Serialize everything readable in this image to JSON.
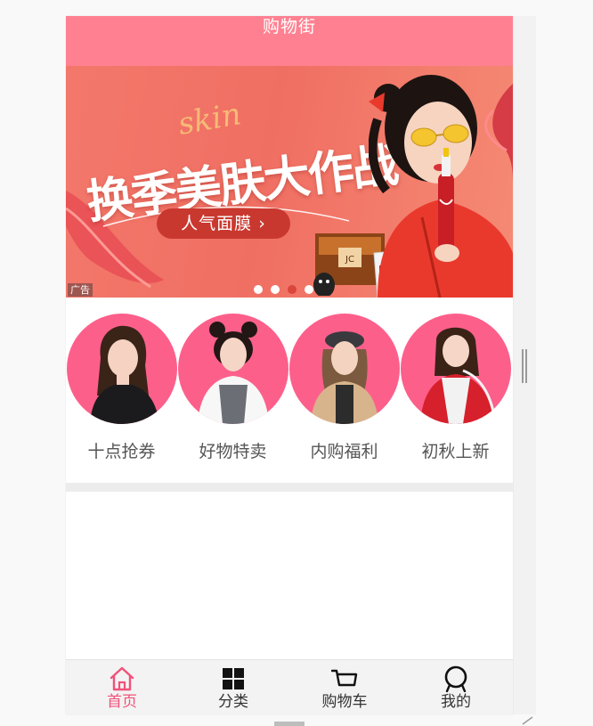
{
  "header": {
    "title": "购物街"
  },
  "banner": {
    "script_text": "skin",
    "headline": "换季美肤大作战",
    "cta_label": "人气面膜 ›",
    "ad_tag": "广告",
    "dots_total": 4,
    "active_dot": 3,
    "colors": {
      "background": "#f3786b",
      "cta": "#c9382f",
      "active_dot": "#d9463b"
    }
  },
  "categories": [
    {
      "label": "十点抢券",
      "icon": "model-black-sweater"
    },
    {
      "label": "好物特卖",
      "icon": "model-buns-white-shirt"
    },
    {
      "label": "内购福利",
      "icon": "model-beret-coat"
    },
    {
      "label": "初秋上新",
      "icon": "model-red-jacket"
    }
  ],
  "tabbar": {
    "items": [
      {
        "label": "首页",
        "icon": "home-icon",
        "active": true
      },
      {
        "label": "分类",
        "icon": "grid-icon",
        "active": false
      },
      {
        "label": "购物车",
        "icon": "cart-icon",
        "active": false
      },
      {
        "label": "我的",
        "icon": "profile-icon",
        "active": false
      }
    ],
    "active_color": "#f0527a"
  },
  "theme": {
    "header_color": "#ff8191",
    "circle_color": "#fd5f8b"
  }
}
